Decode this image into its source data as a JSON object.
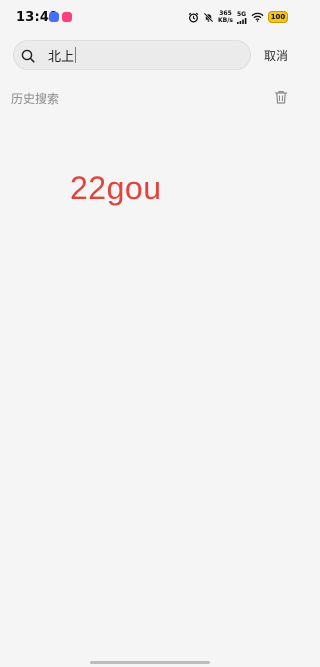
{
  "status_bar": {
    "time": "13:49",
    "net_speed_value": "365",
    "net_speed_unit": "KB/s",
    "network_type": "5G",
    "battery_level": "100"
  },
  "search": {
    "value": "北上",
    "cancel_label": "取消"
  },
  "history": {
    "title": "历史搜索"
  },
  "overlay": {
    "text": "22gou"
  },
  "colors": {
    "background": "#f5f5f5",
    "accent_text": "#e0443c",
    "battery": "#f5c518"
  }
}
